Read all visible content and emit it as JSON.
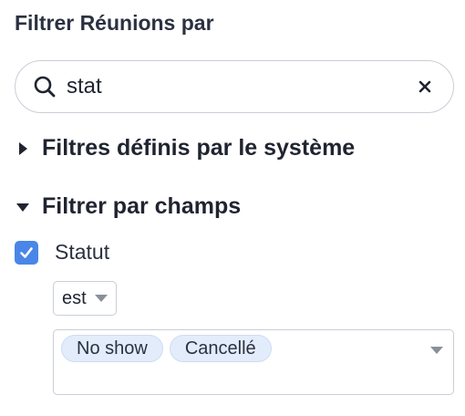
{
  "panel": {
    "title": "Filtrer Réunions par"
  },
  "search": {
    "value": "stat",
    "icon": "search-icon",
    "clear_icon": "close-icon"
  },
  "sections": [
    {
      "label": "Filtres définis par le système",
      "expanded": false
    },
    {
      "label": "Filtrer par champs",
      "expanded": true
    }
  ],
  "field": {
    "label": "Statut",
    "checked": true,
    "operator": "est",
    "values": [
      "No show",
      "Cancellé"
    ]
  },
  "colors": {
    "accent": "#4a86e8",
    "chip_bg": "#e3ecfb",
    "border": "#c9ced6"
  }
}
